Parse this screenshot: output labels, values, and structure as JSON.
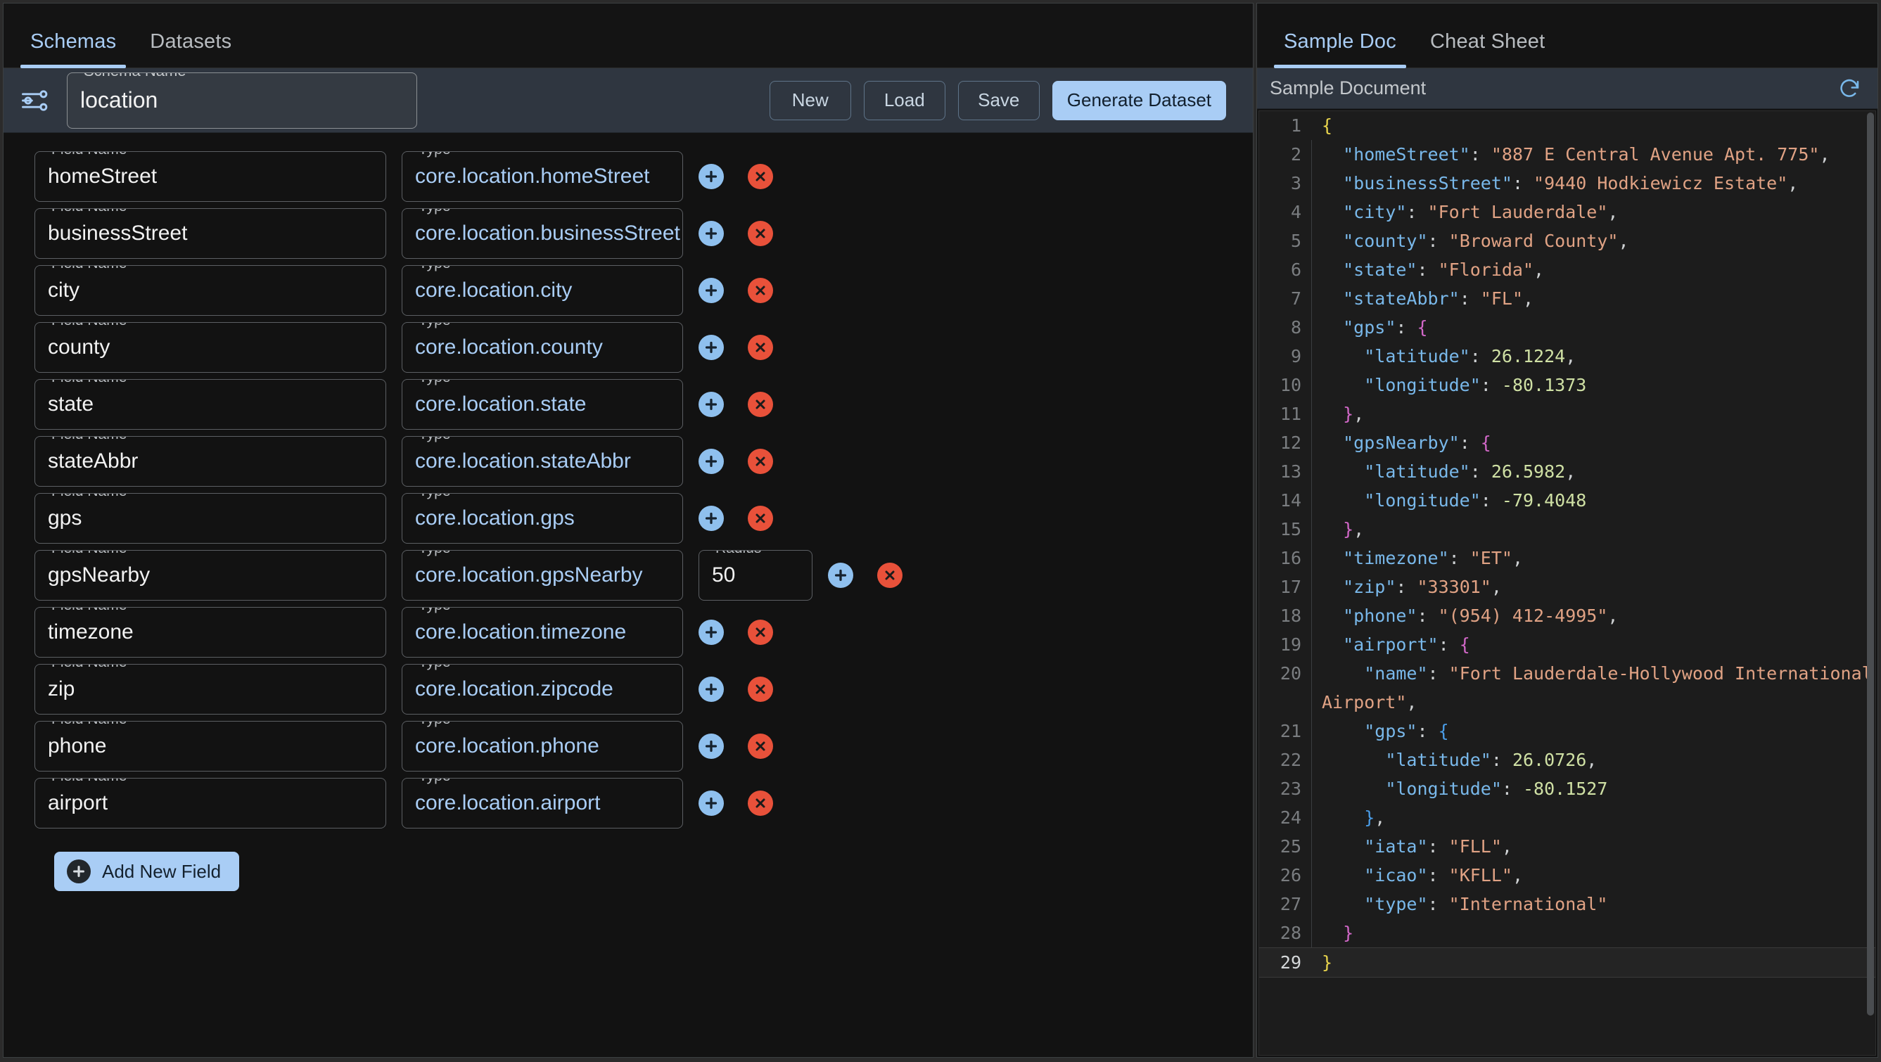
{
  "left": {
    "tabs": [
      {
        "label": "Schemas",
        "active": true
      },
      {
        "label": "Datasets",
        "active": false
      }
    ],
    "schema_name": {
      "label": "Schema Name",
      "value": "location"
    },
    "buttons": {
      "new": "New",
      "load": "Load",
      "save": "Save",
      "generate": "Generate Dataset"
    },
    "labels": {
      "field_name": "Field Name",
      "type": "Type",
      "radius": "Radius"
    },
    "add_new_field": "Add New Field",
    "fields": [
      {
        "name": "homeStreet",
        "type": "core.location.homeStreet"
      },
      {
        "name": "businessStreet",
        "type": "core.location.businessStreet"
      },
      {
        "name": "city",
        "type": "core.location.city"
      },
      {
        "name": "county",
        "type": "core.location.county"
      },
      {
        "name": "state",
        "type": "core.location.state"
      },
      {
        "name": "stateAbbr",
        "type": "core.location.stateAbbr"
      },
      {
        "name": "gps",
        "type": "core.location.gps"
      },
      {
        "name": "gpsNearby",
        "type": "core.location.gpsNearby",
        "radius": "50"
      },
      {
        "name": "timezone",
        "type": "core.location.timezone"
      },
      {
        "name": "zip",
        "type": "core.location.zipcode"
      },
      {
        "name": "phone",
        "type": "core.location.phone"
      },
      {
        "name": "airport",
        "type": "core.location.airport"
      }
    ]
  },
  "right": {
    "tabs": [
      {
        "label": "Sample Doc",
        "active": true
      },
      {
        "label": "Cheat Sheet",
        "active": false
      }
    ],
    "doc_title": "Sample Document",
    "code_lines": [
      {
        "n": "1",
        "guide": false,
        "active": false,
        "tokens": [
          {
            "t": "b0",
            "v": "{"
          }
        ]
      },
      {
        "n": "2",
        "guide": true,
        "active": false,
        "tokens": [
          {
            "t": "key",
            "v": "\"homeStreet\""
          },
          {
            "t": "p",
            "v": ": "
          },
          {
            "t": "str",
            "v": "\"887 E Central Avenue Apt. 775\""
          },
          {
            "t": "p",
            "v": ","
          }
        ],
        "indent": 1
      },
      {
        "n": "3",
        "guide": true,
        "active": false,
        "tokens": [
          {
            "t": "key",
            "v": "\"businessStreet\""
          },
          {
            "t": "p",
            "v": ": "
          },
          {
            "t": "str",
            "v": "\"9440 Hodkiewicz Estate\""
          },
          {
            "t": "p",
            "v": ","
          }
        ],
        "indent": 1
      },
      {
        "n": "4",
        "guide": true,
        "active": false,
        "tokens": [
          {
            "t": "key",
            "v": "\"city\""
          },
          {
            "t": "p",
            "v": ": "
          },
          {
            "t": "str",
            "v": "\"Fort Lauderdale\""
          },
          {
            "t": "p",
            "v": ","
          }
        ],
        "indent": 1
      },
      {
        "n": "5",
        "guide": true,
        "active": false,
        "tokens": [
          {
            "t": "key",
            "v": "\"county\""
          },
          {
            "t": "p",
            "v": ": "
          },
          {
            "t": "str",
            "v": "\"Broward County\""
          },
          {
            "t": "p",
            "v": ","
          }
        ],
        "indent": 1
      },
      {
        "n": "6",
        "guide": true,
        "active": false,
        "tokens": [
          {
            "t": "key",
            "v": "\"state\""
          },
          {
            "t": "p",
            "v": ": "
          },
          {
            "t": "str",
            "v": "\"Florida\""
          },
          {
            "t": "p",
            "v": ","
          }
        ],
        "indent": 1
      },
      {
        "n": "7",
        "guide": true,
        "active": false,
        "tokens": [
          {
            "t": "key",
            "v": "\"stateAbbr\""
          },
          {
            "t": "p",
            "v": ": "
          },
          {
            "t": "str",
            "v": "\"FL\""
          },
          {
            "t": "p",
            "v": ","
          }
        ],
        "indent": 1
      },
      {
        "n": "8",
        "guide": true,
        "active": false,
        "tokens": [
          {
            "t": "key",
            "v": "\"gps\""
          },
          {
            "t": "p",
            "v": ": "
          },
          {
            "t": "b1",
            "v": "{"
          }
        ],
        "indent": 1
      },
      {
        "n": "9",
        "guide": true,
        "active": false,
        "tokens": [
          {
            "t": "key",
            "v": "\"latitude\""
          },
          {
            "t": "p",
            "v": ": "
          },
          {
            "t": "num",
            "v": "26.1224"
          },
          {
            "t": "p",
            "v": ","
          }
        ],
        "indent": 2
      },
      {
        "n": "10",
        "guide": true,
        "active": false,
        "tokens": [
          {
            "t": "key",
            "v": "\"longitude\""
          },
          {
            "t": "p",
            "v": ": "
          },
          {
            "t": "num",
            "v": "-80.1373"
          }
        ],
        "indent": 2
      },
      {
        "n": "11",
        "guide": true,
        "active": false,
        "tokens": [
          {
            "t": "b1",
            "v": "}"
          },
          {
            "t": "p",
            "v": ","
          }
        ],
        "indent": 1
      },
      {
        "n": "12",
        "guide": true,
        "active": false,
        "tokens": [
          {
            "t": "key",
            "v": "\"gpsNearby\""
          },
          {
            "t": "p",
            "v": ": "
          },
          {
            "t": "b1",
            "v": "{"
          }
        ],
        "indent": 1
      },
      {
        "n": "13",
        "guide": true,
        "active": false,
        "tokens": [
          {
            "t": "key",
            "v": "\"latitude\""
          },
          {
            "t": "p",
            "v": ": "
          },
          {
            "t": "num",
            "v": "26.5982"
          },
          {
            "t": "p",
            "v": ","
          }
        ],
        "indent": 2
      },
      {
        "n": "14",
        "guide": true,
        "active": false,
        "tokens": [
          {
            "t": "key",
            "v": "\"longitude\""
          },
          {
            "t": "p",
            "v": ": "
          },
          {
            "t": "num",
            "v": "-79.4048"
          }
        ],
        "indent": 2
      },
      {
        "n": "15",
        "guide": true,
        "active": false,
        "tokens": [
          {
            "t": "b1",
            "v": "}"
          },
          {
            "t": "p",
            "v": ","
          }
        ],
        "indent": 1
      },
      {
        "n": "16",
        "guide": true,
        "active": false,
        "tokens": [
          {
            "t": "key",
            "v": "\"timezone\""
          },
          {
            "t": "p",
            "v": ": "
          },
          {
            "t": "str",
            "v": "\"ET\""
          },
          {
            "t": "p",
            "v": ","
          }
        ],
        "indent": 1
      },
      {
        "n": "17",
        "guide": true,
        "active": false,
        "tokens": [
          {
            "t": "key",
            "v": "\"zip\""
          },
          {
            "t": "p",
            "v": ": "
          },
          {
            "t": "str",
            "v": "\"33301\""
          },
          {
            "t": "p",
            "v": ","
          }
        ],
        "indent": 1
      },
      {
        "n": "18",
        "guide": true,
        "active": false,
        "tokens": [
          {
            "t": "key",
            "v": "\"phone\""
          },
          {
            "t": "p",
            "v": ": "
          },
          {
            "t": "str",
            "v": "\"(954) 412-4995\""
          },
          {
            "t": "p",
            "v": ","
          }
        ],
        "indent": 1
      },
      {
        "n": "19",
        "guide": true,
        "active": false,
        "tokens": [
          {
            "t": "key",
            "v": "\"airport\""
          },
          {
            "t": "p",
            "v": ": "
          },
          {
            "t": "b1",
            "v": "{"
          }
        ],
        "indent": 1
      },
      {
        "n": "20",
        "guide": true,
        "active": false,
        "tokens": [
          {
            "t": "key",
            "v": "\"name\""
          },
          {
            "t": "p",
            "v": ": "
          },
          {
            "t": "str",
            "v": "\"Fort Lauderdale-Hollywood International Airport\""
          },
          {
            "t": "p",
            "v": ","
          }
        ],
        "indent": 2
      },
      {
        "n": "21",
        "guide": true,
        "active": false,
        "tokens": [
          {
            "t": "key",
            "v": "\"gps\""
          },
          {
            "t": "p",
            "v": ": "
          },
          {
            "t": "b2",
            "v": "{"
          }
        ],
        "indent": 2
      },
      {
        "n": "22",
        "guide": true,
        "active": false,
        "tokens": [
          {
            "t": "key",
            "v": "\"latitude\""
          },
          {
            "t": "p",
            "v": ": "
          },
          {
            "t": "num",
            "v": "26.0726"
          },
          {
            "t": "p",
            "v": ","
          }
        ],
        "indent": 3
      },
      {
        "n": "23",
        "guide": true,
        "active": false,
        "tokens": [
          {
            "t": "key",
            "v": "\"longitude\""
          },
          {
            "t": "p",
            "v": ": "
          },
          {
            "t": "num",
            "v": "-80.1527"
          }
        ],
        "indent": 3
      },
      {
        "n": "24",
        "guide": true,
        "active": false,
        "tokens": [
          {
            "t": "b2",
            "v": "}"
          },
          {
            "t": "p",
            "v": ","
          }
        ],
        "indent": 2
      },
      {
        "n": "25",
        "guide": true,
        "active": false,
        "tokens": [
          {
            "t": "key",
            "v": "\"iata\""
          },
          {
            "t": "p",
            "v": ": "
          },
          {
            "t": "str",
            "v": "\"FLL\""
          },
          {
            "t": "p",
            "v": ","
          }
        ],
        "indent": 2
      },
      {
        "n": "26",
        "guide": true,
        "active": false,
        "tokens": [
          {
            "t": "key",
            "v": "\"icao\""
          },
          {
            "t": "p",
            "v": ": "
          },
          {
            "t": "str",
            "v": "\"KFLL\""
          },
          {
            "t": "p",
            "v": ","
          }
        ],
        "indent": 2
      },
      {
        "n": "27",
        "guide": true,
        "active": false,
        "tokens": [
          {
            "t": "key",
            "v": "\"type\""
          },
          {
            "t": "p",
            "v": ": "
          },
          {
            "t": "str",
            "v": "\"International\""
          }
        ],
        "indent": 2
      },
      {
        "n": "28",
        "guide": true,
        "active": false,
        "tokens": [
          {
            "t": "b1",
            "v": "}"
          }
        ],
        "indent": 1
      },
      {
        "n": "29",
        "guide": false,
        "active": true,
        "tokens": [
          {
            "t": "b0",
            "v": "}"
          }
        ],
        "indent": 0
      }
    ]
  },
  "icons": {
    "sliders": "sliders-icon",
    "refresh": "refresh-icon",
    "add": "plus-circle-icon",
    "delete": "close-circle-icon"
  },
  "colors": {
    "accent": "#a9cdf5",
    "danger": "#e8513a",
    "panel": "#121212",
    "bar": "#2f3640"
  }
}
